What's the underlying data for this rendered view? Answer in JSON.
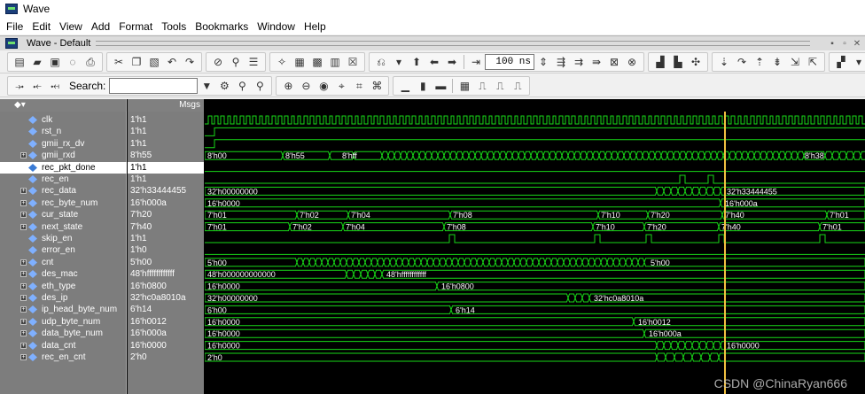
{
  "window": {
    "title": "Wave"
  },
  "menu": [
    "File",
    "Edit",
    "View",
    "Add",
    "Format",
    "Tools",
    "Bookmarks",
    "Window",
    "Help"
  ],
  "wave_header": {
    "title": "Wave - Default"
  },
  "toolbar": {
    "search_label": "Search:",
    "search_value": "",
    "time_step": "100 ns"
  },
  "columns": {
    "msgs": "Msgs"
  },
  "signals": [
    {
      "name": "clk",
      "value": "1'h1",
      "expandable": false,
      "kind": "clock"
    },
    {
      "name": "rst_n",
      "value": "1'h1",
      "expandable": false,
      "kind": "bit"
    },
    {
      "name": "gmii_rx_dv",
      "value": "1'h1",
      "expandable": false,
      "kind": "bit"
    },
    {
      "name": "gmii_rxd",
      "value": "8'h55",
      "expandable": true,
      "kind": "bus"
    },
    {
      "name": "rec_pkt_done",
      "value": "1'h1",
      "expandable": false,
      "kind": "bit",
      "selected": true
    },
    {
      "name": "rec_en",
      "value": "1'h1",
      "expandable": false,
      "kind": "bit"
    },
    {
      "name": "rec_data",
      "value": "32'h33444455",
      "expandable": true,
      "kind": "bus"
    },
    {
      "name": "rec_byte_num",
      "value": "16'h000a",
      "expandable": true,
      "kind": "bus"
    },
    {
      "name": "cur_state",
      "value": "7'h20",
      "expandable": true,
      "kind": "bus"
    },
    {
      "name": "next_state",
      "value": "7'h40",
      "expandable": true,
      "kind": "bus"
    },
    {
      "name": "skip_en",
      "value": "1'h1",
      "expandable": false,
      "kind": "bit"
    },
    {
      "name": "error_en",
      "value": "1'h0",
      "expandable": false,
      "kind": "bit"
    },
    {
      "name": "cnt",
      "value": "5'h00",
      "expandable": true,
      "kind": "bus"
    },
    {
      "name": "des_mac",
      "value": "48'hffffffffffff",
      "expandable": true,
      "kind": "bus"
    },
    {
      "name": "eth_type",
      "value": "16'h0800",
      "expandable": true,
      "kind": "bus"
    },
    {
      "name": "des_ip",
      "value": "32'hc0a8010a",
      "expandable": true,
      "kind": "bus"
    },
    {
      "name": "ip_head_byte_num",
      "value": "6'h14",
      "expandable": true,
      "kind": "bus"
    },
    {
      "name": "udp_byte_num",
      "value": "16'h0012",
      "expandable": true,
      "kind": "bus"
    },
    {
      "name": "data_byte_num",
      "value": "16'h000a",
      "expandable": true,
      "kind": "bus"
    },
    {
      "name": "data_cnt",
      "value": "16'h0000",
      "expandable": true,
      "kind": "bus"
    },
    {
      "name": "rec_en_cnt",
      "value": "2'h0",
      "expandable": true,
      "kind": "bus"
    }
  ],
  "wave_labels": {
    "gmii_rxd": [
      "8'h00",
      "8'h55",
      "8'hff",
      "8'h38"
    ],
    "rec_data": [
      "32'h00000000",
      "32'h33444455"
    ],
    "rec_byte_num": [
      "16'h0000",
      "16'h000a"
    ],
    "cur_state": [
      "7'h01",
      "7'h02",
      "7'h04",
      "7'h08",
      "7'h10",
      "7'h20",
      "7'h40",
      "7'h01"
    ],
    "next_state": [
      "7'h01",
      "7'h02",
      "7'h04",
      "7'h08",
      "7'h10",
      "7'h20",
      "7'h40",
      "7'h01"
    ],
    "cnt": [
      "5'h00",
      "5'h00"
    ],
    "des_mac": [
      "48'h000000000000",
      "48'hffffffffffff"
    ],
    "eth_type": [
      "16'h0000",
      "16'h0800"
    ],
    "des_ip": [
      "32'h00000000",
      "32'hc0a8010a"
    ],
    "ip_head_byte_num": [
      "6'h00",
      "6'h14"
    ],
    "udp_byte_num": [
      "16'h0000",
      "16'h0012"
    ],
    "data_byte_num": [
      "16'h0000",
      "16'h000a"
    ],
    "data_cnt": [
      "16'h0000",
      "16'h0000"
    ],
    "rec_en_cnt": [
      "2'h0"
    ]
  },
  "colors": {
    "wave_green": "#18d818",
    "cursor": "#f0c040",
    "selected_bg": "#ffffff",
    "panel_gray": "#7d7d7d"
  },
  "watermark": "CSDN @ChinaRyan666"
}
